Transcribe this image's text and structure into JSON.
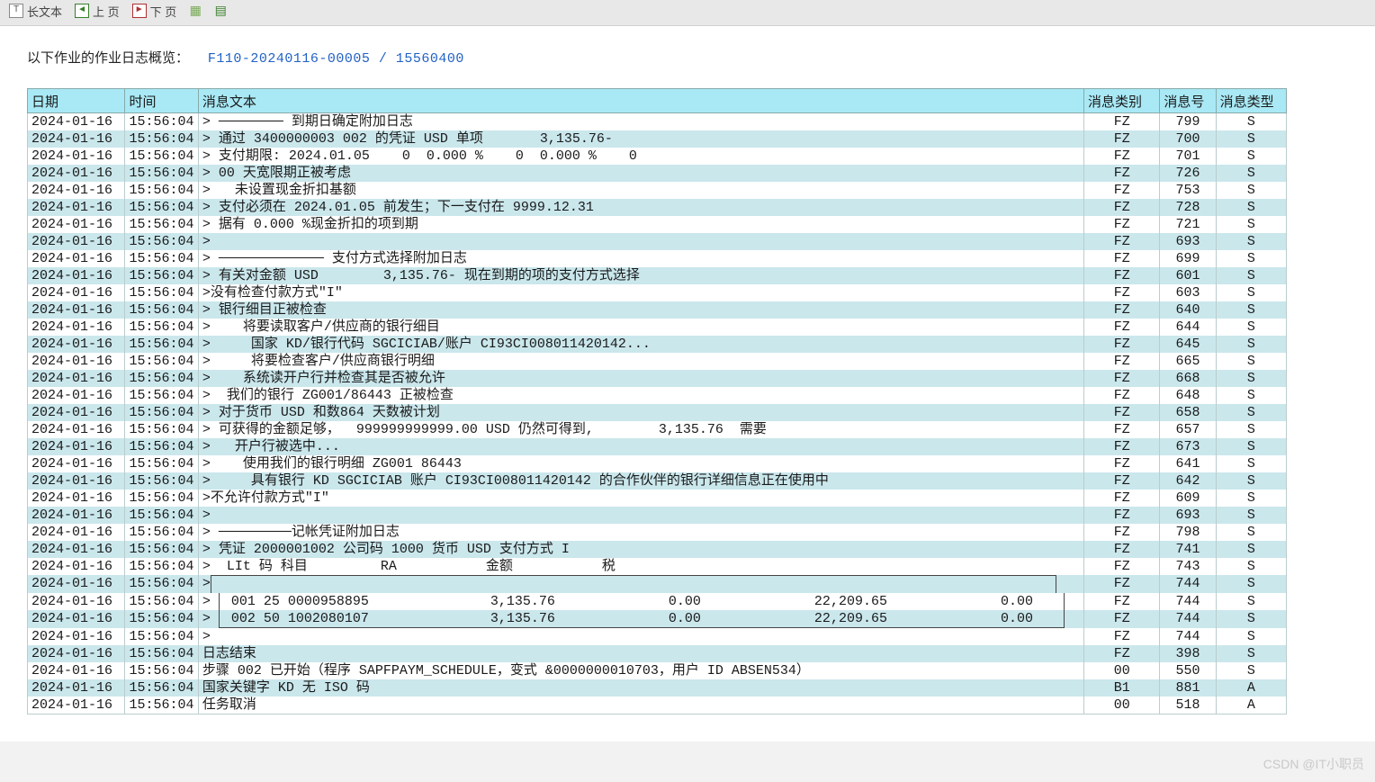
{
  "toolbar": {
    "long_text_label": "长文本",
    "prev_page_label": "上 页",
    "next_page_label": "下 页"
  },
  "overview": {
    "label": "以下作业的作业日志概览：",
    "job_id": "F110-20240116-00005 / 15560400"
  },
  "headers": {
    "date": "日期",
    "time": "时间",
    "msg_text": "消息文本",
    "msg_cat": "消息类别",
    "msg_no": "消息号",
    "msg_type": "消息类型"
  },
  "rows": [
    {
      "date": "2024-01-16",
      "time": "15:56:04",
      "text": "> ──────── 到期日确定附加日志",
      "cat": "FZ",
      "no": "799",
      "type": "S"
    },
    {
      "date": "2024-01-16",
      "time": "15:56:04",
      "text": "> 通过 3400000003 002 的凭证 USD 单项       3,135.76-",
      "cat": "FZ",
      "no": "700",
      "type": "S"
    },
    {
      "date": "2024-01-16",
      "time": "15:56:04",
      "text": "> 支付期限: 2024.01.05    0  0.000 %    0  0.000 %    0",
      "cat": "FZ",
      "no": "701",
      "type": "S"
    },
    {
      "date": "2024-01-16",
      "time": "15:56:04",
      "text": "> 00 天宽限期正被考虑",
      "cat": "FZ",
      "no": "726",
      "type": "S"
    },
    {
      "date": "2024-01-16",
      "time": "15:56:04",
      "text": ">   未设置现金折扣基额",
      "cat": "FZ",
      "no": "753",
      "type": "S"
    },
    {
      "date": "2024-01-16",
      "time": "15:56:04",
      "text": "> 支付必须在 2024.01.05 前发生；下一支付在 9999.12.31",
      "cat": "FZ",
      "no": "728",
      "type": "S"
    },
    {
      "date": "2024-01-16",
      "time": "15:56:04",
      "text": "> 据有 0.000 %现金折扣的项到期",
      "cat": "FZ",
      "no": "721",
      "type": "S"
    },
    {
      "date": "2024-01-16",
      "time": "15:56:04",
      "text": ">",
      "cat": "FZ",
      "no": "693",
      "type": "S"
    },
    {
      "date": "2024-01-16",
      "time": "15:56:04",
      "text": "> ───────────── 支付方式选择附加日志",
      "cat": "FZ",
      "no": "699",
      "type": "S"
    },
    {
      "date": "2024-01-16",
      "time": "15:56:04",
      "text": "> 有关对金额 USD        3,135.76- 现在到期的项的支付方式选择",
      "cat": "FZ",
      "no": "601",
      "type": "S"
    },
    {
      "date": "2024-01-16",
      "time": "15:56:04",
      "text": ">没有检查付款方式\"I\"",
      "cat": "FZ",
      "no": "603",
      "type": "S"
    },
    {
      "date": "2024-01-16",
      "time": "15:56:04",
      "text": "> 银行细目正被检查",
      "cat": "FZ",
      "no": "640",
      "type": "S"
    },
    {
      "date": "2024-01-16",
      "time": "15:56:04",
      "text": ">    将要读取客户/供应商的银行细目",
      "cat": "FZ",
      "no": "644",
      "type": "S"
    },
    {
      "date": "2024-01-16",
      "time": "15:56:04",
      "text": ">     国家 KD/银行代码 SGCICIAB/账户 CI93CI008011420142...",
      "cat": "FZ",
      "no": "645",
      "type": "S"
    },
    {
      "date": "2024-01-16",
      "time": "15:56:04",
      "text": ">     将要检查客户/供应商银行明细",
      "cat": "FZ",
      "no": "665",
      "type": "S"
    },
    {
      "date": "2024-01-16",
      "time": "15:56:04",
      "text": ">    系统读开户行并检查其是否被允许",
      "cat": "FZ",
      "no": "668",
      "type": "S"
    },
    {
      "date": "2024-01-16",
      "time": "15:56:04",
      "text": ">  我们的银行 ZG001/86443 正被检查",
      "cat": "FZ",
      "no": "648",
      "type": "S"
    },
    {
      "date": "2024-01-16",
      "time": "15:56:04",
      "text": "> 对于货币 USD 和数864 天数被计划",
      "cat": "FZ",
      "no": "658",
      "type": "S"
    },
    {
      "date": "2024-01-16",
      "time": "15:56:04",
      "text": "> 可获得的金额足够，  999999999999.00 USD 仍然可得到,        3,135.76  需要",
      "cat": "FZ",
      "no": "657",
      "type": "S"
    },
    {
      "date": "2024-01-16",
      "time": "15:56:04",
      "text": ">   开户行被选中...",
      "cat": "FZ",
      "no": "673",
      "type": "S"
    },
    {
      "date": "2024-01-16",
      "time": "15:56:04",
      "text": ">    使用我们的银行明细 ZG001 86443",
      "cat": "FZ",
      "no": "641",
      "type": "S"
    },
    {
      "date": "2024-01-16",
      "time": "15:56:04",
      "text": ">     具有银行 KD SGCICIAB 账户 CI93CI008011420142 的合作伙伴的银行详细信息正在使用中",
      "cat": "FZ",
      "no": "642",
      "type": "S"
    },
    {
      "date": "2024-01-16",
      "time": "15:56:04",
      "text": ">不允许付款方式\"I\"",
      "cat": "FZ",
      "no": "609",
      "type": "S"
    },
    {
      "date": "2024-01-16",
      "time": "15:56:04",
      "text": ">",
      "cat": "FZ",
      "no": "693",
      "type": "S"
    },
    {
      "date": "2024-01-16",
      "time": "15:56:04",
      "text": "> ─────────记帐凭证附加日志",
      "cat": "FZ",
      "no": "798",
      "type": "S"
    },
    {
      "date": "2024-01-16",
      "time": "15:56:04",
      "text": "> 凭证 2000001002 公司码 1000 货币 USD 支付方式 I",
      "cat": "FZ",
      "no": "741",
      "type": "S"
    },
    {
      "date": "2024-01-16",
      "time": "15:56:04",
      "text": ">  LIt 码 科目         RA           金额           税",
      "cat": "FZ",
      "no": "743",
      "type": "S"
    },
    {
      "date": "2024-01-16",
      "time": "15:56:04",
      "text": ">",
      "cat": "FZ",
      "no": "744",
      "type": "S",
      "box": "top"
    },
    {
      "date": "2024-01-16",
      "time": "15:56:04",
      "text": ">  001 25 0000958895               3,135.76              0.00              22,209.65              0.00",
      "cat": "FZ",
      "no": "744",
      "type": "S",
      "box": "mid"
    },
    {
      "date": "2024-01-16",
      "time": "15:56:04",
      "text": ">  002 50 1002080107               3,135.76              0.00              22,209.65              0.00",
      "cat": "FZ",
      "no": "744",
      "type": "S",
      "box": "bot"
    },
    {
      "date": "2024-01-16",
      "time": "15:56:04",
      "text": ">",
      "cat": "FZ",
      "no": "744",
      "type": "S"
    },
    {
      "date": "2024-01-16",
      "time": "15:56:04",
      "text": "日志结束",
      "cat": "FZ",
      "no": "398",
      "type": "S"
    },
    {
      "date": "2024-01-16",
      "time": "15:56:04",
      "text": "步骤 002 已开始（程序 SAPFPAYM_SCHEDULE，变式 &0000000010703，用户 ID ABSEN534）",
      "cat": "00",
      "no": "550",
      "type": "S"
    },
    {
      "date": "2024-01-16",
      "time": "15:56:04",
      "text": "国家关键字 KD 无 ISO 码",
      "cat": "B1",
      "no": "881",
      "type": "A"
    },
    {
      "date": "2024-01-16",
      "time": "15:56:04",
      "text": "任务取消",
      "cat": "00",
      "no": "518",
      "type": "A"
    }
  ],
  "watermark": "CSDN @IT小职员"
}
